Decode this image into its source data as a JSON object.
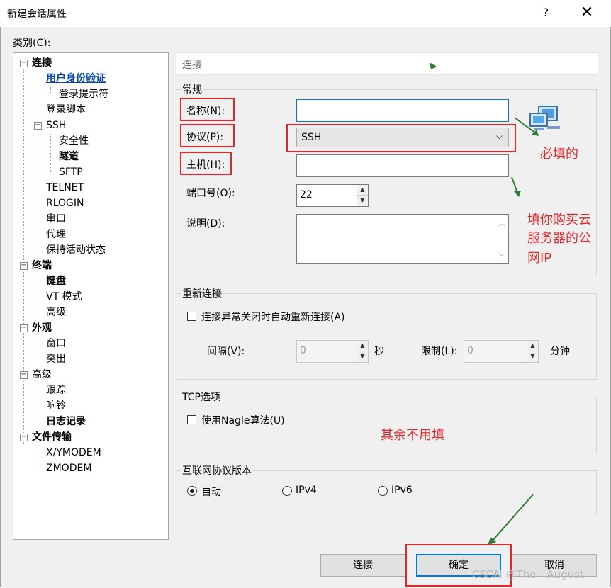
{
  "window": {
    "title": "新建会话属性",
    "help_glyph": "?",
    "close_glyph": "✕"
  },
  "category_label": "类别(C):",
  "tree": {
    "items": [
      "连接",
      "用户身份验证",
      "登录提示符",
      "登录脚本",
      "SSH",
      "安全性",
      "隧道",
      "SFTP",
      "TELNET",
      "RLOGIN",
      "串口",
      "代理",
      "保持活动状态",
      "终端",
      "键盘",
      "VT 模式",
      "高级",
      "外观",
      "窗口",
      "突出",
      "高级",
      "跟踪",
      "响铃",
      "日志记录",
      "文件传输",
      "X/YMODEM",
      "ZMODEM"
    ],
    "selected": "用户身份验证"
  },
  "header": {
    "text": "连接"
  },
  "general": {
    "title": "常规",
    "name_label": "名称(N):",
    "name_value": "",
    "protocol_label": "协议(P):",
    "protocol_value": "SSH",
    "host_label": "主机(H):",
    "host_value": "",
    "port_label": "端口号(O):",
    "port_value": "22",
    "desc_label": "说明(D):",
    "desc_value": ""
  },
  "reconnect": {
    "title": "重新连接",
    "checkbox_label": "连接异常关闭时自动重新连接(A)",
    "interval_label": "间隔(V):",
    "interval_value": "0",
    "seconds_unit": "秒",
    "limit_label": "限制(L):",
    "limit_value": "0",
    "minutes_unit": "分钟"
  },
  "tcp": {
    "title": "TCP选项",
    "checkbox_label": "使用Nagle算法(U)"
  },
  "ip_version": {
    "title": "互联网协议版本",
    "options": [
      "自动",
      "IPv4",
      "IPv6"
    ],
    "selected": "自动"
  },
  "buttons": {
    "connect": "连接",
    "ok": "确定",
    "cancel": "取消"
  },
  "annotations": {
    "required": "必填的",
    "host_hint_1": "填你购买云",
    "host_hint_2": "服务器的公",
    "host_hint_3": "网IP",
    "rest": "其余不用填",
    "color": "#e3262a",
    "arrow_color": "#2e7d32"
  },
  "watermark": "CSDN @The　August"
}
